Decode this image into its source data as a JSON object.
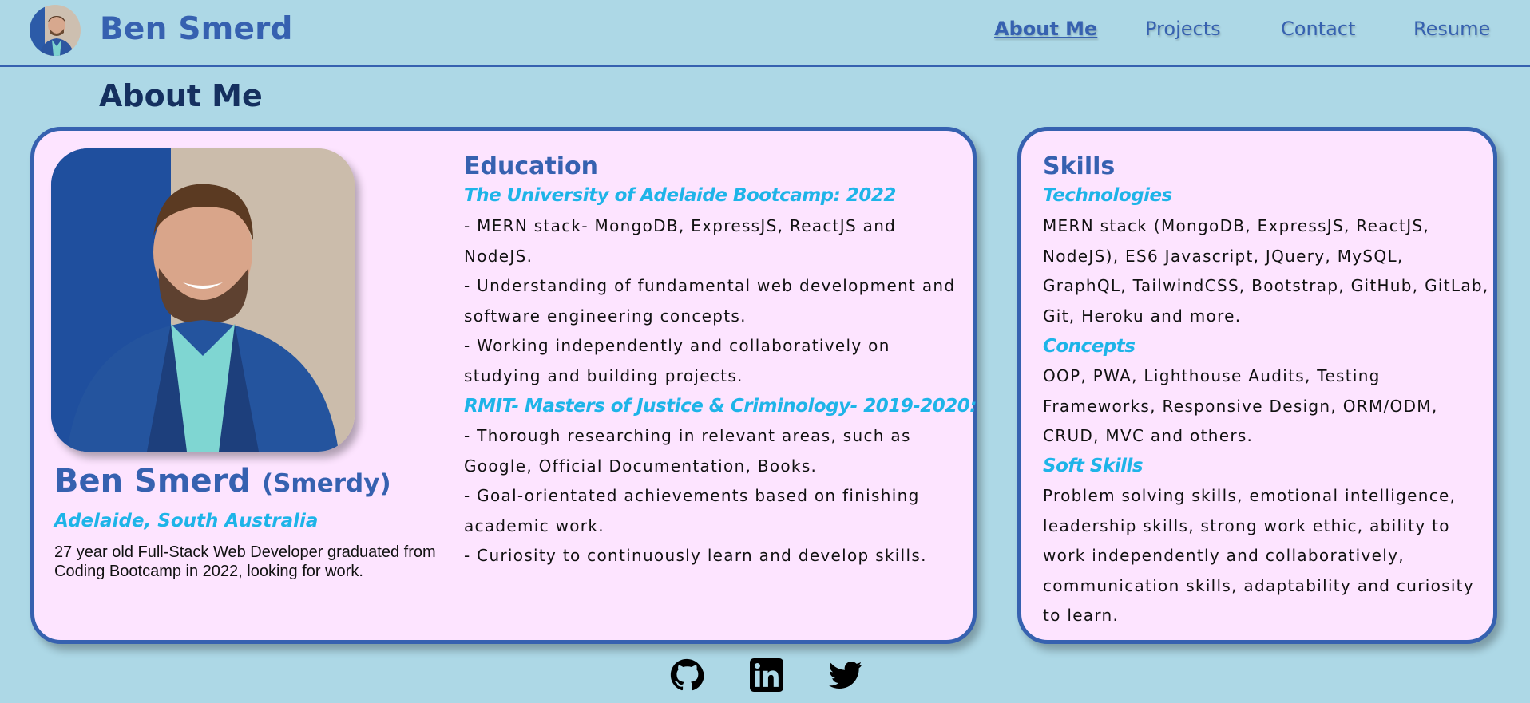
{
  "header": {
    "brand": "Ben Smerd",
    "nav": [
      {
        "label": "About Me",
        "active": true
      },
      {
        "label": "Projects",
        "active": false
      },
      {
        "label": "Contact",
        "active": false
      },
      {
        "label": "Resume",
        "active": false
      }
    ]
  },
  "page_title": "About Me",
  "profile": {
    "name": "Ben Smerd",
    "nickname": "(Smerdy)",
    "location": "Adelaide, South Australia",
    "bio": "27 year old Full-Stack Web Developer graduated from Coding Bootcamp in 2022, looking for work."
  },
  "education": {
    "heading": "Education",
    "items": [
      {
        "title": "The University of Adelaide Bootcamp: 2022",
        "points": [
          "- MERN stack- MongoDB, ExpressJS, ReactJS and NodeJS.",
          "- Understanding of fundamental web development and software engineering concepts.",
          "- Working independently and collaboratively on studying and building projects."
        ]
      },
      {
        "title": "RMIT- Masters of Justice & Criminology- 2019-2020:",
        "points": [
          "- Thorough researching in relevant areas, such as Google, Official Documentation, Books.",
          "- Goal-orientated achievements based on finishing academic work.",
          "- Curiosity to continuously learn and develop skills."
        ]
      }
    ]
  },
  "skills": {
    "heading": "Skills",
    "groups": [
      {
        "title": "Technologies",
        "text": "MERN stack (MongoDB, ExpressJS, ReactJS, NodeJS), ES6 Javascript, JQuery, MySQL, GraphQL, TailwindCSS, Bootstrap, GitHub, GitLab, Git, Heroku and more."
      },
      {
        "title": "Concepts",
        "text": "OOP, PWA, Lighthouse Audits, Testing Frameworks, Responsive Design, ORM/ODM, CRUD, MVC and others."
      },
      {
        "title": "Soft Skills",
        "text": "Problem solving skills, emotional intelligence, leadership skills, strong work ethic, ability to work independently and collaboratively, communication skills, adaptability and curiosity to learn."
      }
    ]
  },
  "socials": [
    {
      "icon": "github-icon"
    },
    {
      "icon": "linkedin-icon"
    },
    {
      "icon": "twitter-icon"
    }
  ],
  "colors": {
    "background": "#add8e6",
    "accent": "#3661b0",
    "highlight": "#1eb4e8",
    "card": "#fde4ff"
  }
}
